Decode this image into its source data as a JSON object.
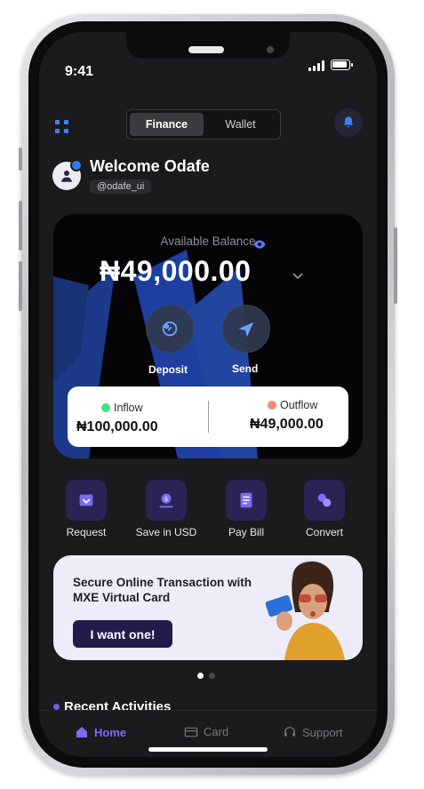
{
  "status": {
    "time": "9:41"
  },
  "header": {
    "tabs": [
      {
        "label": "Finance",
        "active": true
      },
      {
        "label": "Wallet",
        "active": false
      }
    ],
    "welcome": "Welcome Odafe",
    "handle": "@odafe_ui"
  },
  "balance": {
    "label": "Available Balance",
    "amount": "₦49,000.00",
    "actions": [
      {
        "label": "Deposit",
        "icon": "deposit-icon"
      },
      {
        "label": "Send",
        "icon": "send-icon"
      }
    ],
    "inflow": {
      "label": "Inflow",
      "value": "₦100,000.00",
      "color": "#4ade80"
    },
    "outflow": {
      "label": "Outflow",
      "value": "₦49,000.00",
      "color": "#f08c72"
    }
  },
  "quick_actions": [
    {
      "label": "Request",
      "icon": "request-icon"
    },
    {
      "label": "Save in USD",
      "icon": "dollar-savings-icon"
    },
    {
      "label": "Pay Bill",
      "icon": "bill-icon"
    },
    {
      "label": "Convert",
      "icon": "convert-icon"
    }
  ],
  "promo": {
    "title": "Secure Online Transaction with MXE Virtual Card",
    "button": "I want one!"
  },
  "carousel": {
    "active_index": 0,
    "count": 2
  },
  "recent": {
    "title": "Recent Activities"
  },
  "bottom_nav": [
    {
      "label": "Home",
      "icon": "home-icon",
      "active": true
    },
    {
      "label": "Card",
      "icon": "card-icon",
      "active": false
    },
    {
      "label": "Support",
      "icon": "headset-icon",
      "active": false
    }
  ],
  "colors": {
    "accent": "#6d5ef2",
    "screen": "#1b1b1d",
    "icon_tile": "#2a2456"
  }
}
